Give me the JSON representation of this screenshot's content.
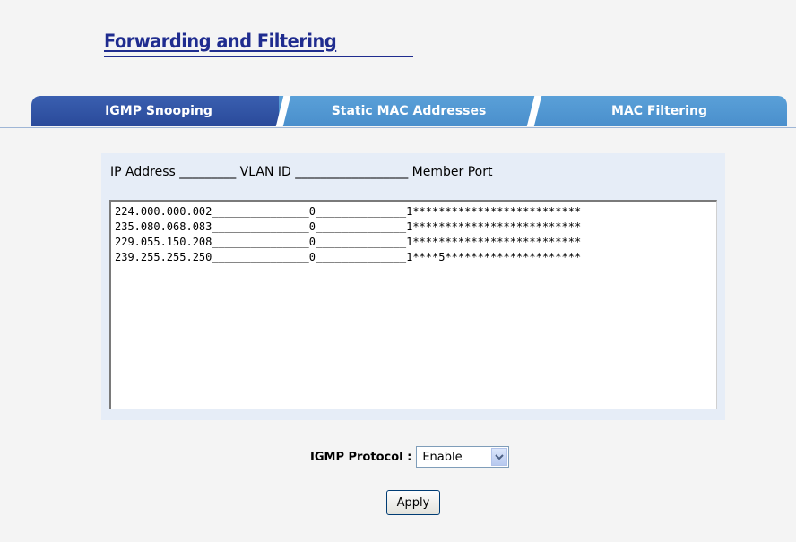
{
  "page": {
    "title": "Forwarding and Filtering"
  },
  "tabs": [
    {
      "label": "IGMP Snooping",
      "active": true
    },
    {
      "label": "Static MAC Addresses",
      "active": false
    },
    {
      "label": "MAC Filtering",
      "active": false
    }
  ],
  "multicast_table": {
    "header": "IP Address _________ VLAN ID __________________ Member Port",
    "rows": [
      "224.000.000.002_______________0______________1**************************",
      "235.080.068.083_______________0______________1**************************",
      "229.055.150.208_______________0______________1**************************",
      "239.255.255.250_______________0______________1****5*********************"
    ]
  },
  "igmp_protocol": {
    "label": "IGMP Protocol :",
    "selected": "Enable"
  },
  "actions": {
    "apply_label": "Apply"
  },
  "colors": {
    "title": "#1f2c8f",
    "active_tab": "#2a4a9a",
    "inactive_tab": "#4a8fcc",
    "panel_bg": "#e6edf7"
  },
  "icons": {
    "select_arrow": "chevron-down-icon"
  }
}
